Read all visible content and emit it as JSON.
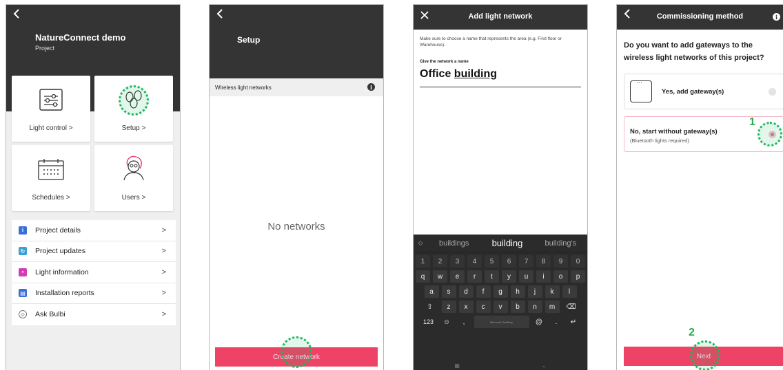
{
  "screen1": {
    "project_name": "NatureConnect demo",
    "project_sub": "Project",
    "tiles": {
      "light_control": "Light control",
      "setup": "Setup",
      "schedules": "Schedules",
      "users": "Users",
      "chevron": ">"
    },
    "menu": [
      {
        "label": "Project details",
        "color": "#3b6fd8",
        "icon": "info-icon"
      },
      {
        "label": "Project updates",
        "color": "#3aa0d8",
        "icon": "refresh-icon"
      },
      {
        "label": "Light information",
        "color": "#d43bb5",
        "icon": "bulb-icon"
      },
      {
        "label": "Installation reports",
        "color": "#3b6fd8",
        "icon": "report-icon"
      },
      {
        "label": "Ask Bulbi",
        "color": "#ffffff",
        "icon": "bulbi-icon"
      }
    ],
    "menu_chevron": ">"
  },
  "screen2": {
    "title": "Setup",
    "section": "Wireless light networks",
    "empty": "No networks",
    "button": "Create network"
  },
  "screen3": {
    "title": "Add light network",
    "help": "Make sure to choose a name that represents the area (e.g. First floor or Warehouse).",
    "field_label": "Give the network a name",
    "field_value_1": "Office ",
    "field_value_2": "building",
    "suggestions": [
      "buildings",
      "building",
      "building's"
    ],
    "num_row": [
      "1",
      "2",
      "3",
      "4",
      "5",
      "6",
      "7",
      "8",
      "9",
      "0"
    ],
    "row1": [
      "q",
      "w",
      "e",
      "r",
      "t",
      "y",
      "u",
      "i",
      "o",
      "p"
    ],
    "row2": [
      "a",
      "s",
      "d",
      "f",
      "g",
      "h",
      "j",
      "k",
      "l"
    ],
    "row3": [
      "z",
      "x",
      "c",
      "v",
      "b",
      "n",
      "m"
    ],
    "key_123": "123",
    "space_hint": "Microsoft SwiftKey"
  },
  "screen4": {
    "title": "Commissioning method",
    "question": "Do you want to add gateways to the wireless light networks of this project?",
    "opt1": "Yes, add gateway(s)",
    "opt2": "No, start without gateway(s)",
    "opt2_sub": "(Bluetooth lights required)",
    "button": "Next",
    "step1": "1",
    "step2": "2"
  },
  "colors": {
    "accent": "#ee4266",
    "header": "#343434",
    "callout": "#1bb85a"
  }
}
